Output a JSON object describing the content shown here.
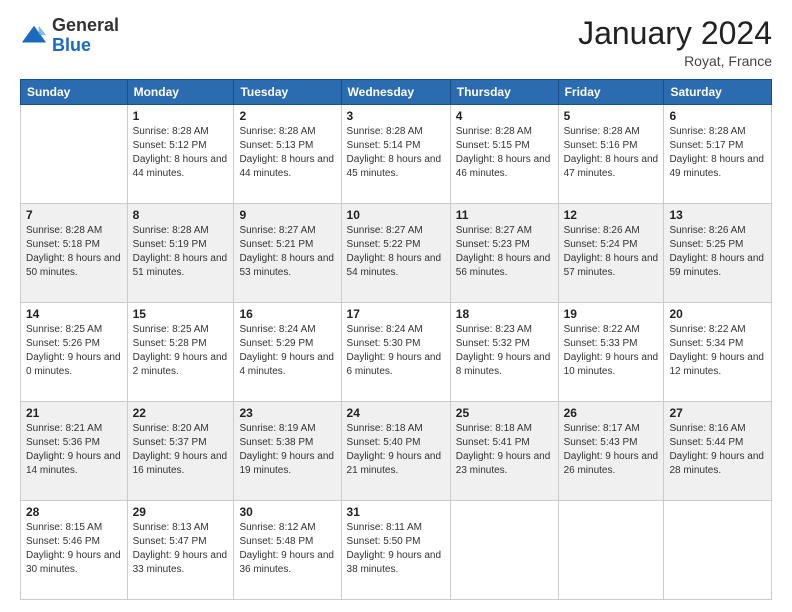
{
  "logo": {
    "general": "General",
    "blue": "Blue"
  },
  "header": {
    "title": "January 2024",
    "location": "Royat, France"
  },
  "weekdays": [
    "Sunday",
    "Monday",
    "Tuesday",
    "Wednesday",
    "Thursday",
    "Friday",
    "Saturday"
  ],
  "weeks": [
    [
      {
        "day": "",
        "sunrise": "",
        "sunset": "",
        "daylight": ""
      },
      {
        "day": "1",
        "sunrise": "Sunrise: 8:28 AM",
        "sunset": "Sunset: 5:12 PM",
        "daylight": "Daylight: 8 hours and 44 minutes."
      },
      {
        "day": "2",
        "sunrise": "Sunrise: 8:28 AM",
        "sunset": "Sunset: 5:13 PM",
        "daylight": "Daylight: 8 hours and 44 minutes."
      },
      {
        "day": "3",
        "sunrise": "Sunrise: 8:28 AM",
        "sunset": "Sunset: 5:14 PM",
        "daylight": "Daylight: 8 hours and 45 minutes."
      },
      {
        "day": "4",
        "sunrise": "Sunrise: 8:28 AM",
        "sunset": "Sunset: 5:15 PM",
        "daylight": "Daylight: 8 hours and 46 minutes."
      },
      {
        "day": "5",
        "sunrise": "Sunrise: 8:28 AM",
        "sunset": "Sunset: 5:16 PM",
        "daylight": "Daylight: 8 hours and 47 minutes."
      },
      {
        "day": "6",
        "sunrise": "Sunrise: 8:28 AM",
        "sunset": "Sunset: 5:17 PM",
        "daylight": "Daylight: 8 hours and 49 minutes."
      }
    ],
    [
      {
        "day": "7",
        "sunrise": "Sunrise: 8:28 AM",
        "sunset": "Sunset: 5:18 PM",
        "daylight": "Daylight: 8 hours and 50 minutes."
      },
      {
        "day": "8",
        "sunrise": "Sunrise: 8:28 AM",
        "sunset": "Sunset: 5:19 PM",
        "daylight": "Daylight: 8 hours and 51 minutes."
      },
      {
        "day": "9",
        "sunrise": "Sunrise: 8:27 AM",
        "sunset": "Sunset: 5:21 PM",
        "daylight": "Daylight: 8 hours and 53 minutes."
      },
      {
        "day": "10",
        "sunrise": "Sunrise: 8:27 AM",
        "sunset": "Sunset: 5:22 PM",
        "daylight": "Daylight: 8 hours and 54 minutes."
      },
      {
        "day": "11",
        "sunrise": "Sunrise: 8:27 AM",
        "sunset": "Sunset: 5:23 PM",
        "daylight": "Daylight: 8 hours and 56 minutes."
      },
      {
        "day": "12",
        "sunrise": "Sunrise: 8:26 AM",
        "sunset": "Sunset: 5:24 PM",
        "daylight": "Daylight: 8 hours and 57 minutes."
      },
      {
        "day": "13",
        "sunrise": "Sunrise: 8:26 AM",
        "sunset": "Sunset: 5:25 PM",
        "daylight": "Daylight: 8 hours and 59 minutes."
      }
    ],
    [
      {
        "day": "14",
        "sunrise": "Sunrise: 8:25 AM",
        "sunset": "Sunset: 5:26 PM",
        "daylight": "Daylight: 9 hours and 0 minutes."
      },
      {
        "day": "15",
        "sunrise": "Sunrise: 8:25 AM",
        "sunset": "Sunset: 5:28 PM",
        "daylight": "Daylight: 9 hours and 2 minutes."
      },
      {
        "day": "16",
        "sunrise": "Sunrise: 8:24 AM",
        "sunset": "Sunset: 5:29 PM",
        "daylight": "Daylight: 9 hours and 4 minutes."
      },
      {
        "day": "17",
        "sunrise": "Sunrise: 8:24 AM",
        "sunset": "Sunset: 5:30 PM",
        "daylight": "Daylight: 9 hours and 6 minutes."
      },
      {
        "day": "18",
        "sunrise": "Sunrise: 8:23 AM",
        "sunset": "Sunset: 5:32 PM",
        "daylight": "Daylight: 9 hours and 8 minutes."
      },
      {
        "day": "19",
        "sunrise": "Sunrise: 8:22 AM",
        "sunset": "Sunset: 5:33 PM",
        "daylight": "Daylight: 9 hours and 10 minutes."
      },
      {
        "day": "20",
        "sunrise": "Sunrise: 8:22 AM",
        "sunset": "Sunset: 5:34 PM",
        "daylight": "Daylight: 9 hours and 12 minutes."
      }
    ],
    [
      {
        "day": "21",
        "sunrise": "Sunrise: 8:21 AM",
        "sunset": "Sunset: 5:36 PM",
        "daylight": "Daylight: 9 hours and 14 minutes."
      },
      {
        "day": "22",
        "sunrise": "Sunrise: 8:20 AM",
        "sunset": "Sunset: 5:37 PM",
        "daylight": "Daylight: 9 hours and 16 minutes."
      },
      {
        "day": "23",
        "sunrise": "Sunrise: 8:19 AM",
        "sunset": "Sunset: 5:38 PM",
        "daylight": "Daylight: 9 hours and 19 minutes."
      },
      {
        "day": "24",
        "sunrise": "Sunrise: 8:18 AM",
        "sunset": "Sunset: 5:40 PM",
        "daylight": "Daylight: 9 hours and 21 minutes."
      },
      {
        "day": "25",
        "sunrise": "Sunrise: 8:18 AM",
        "sunset": "Sunset: 5:41 PM",
        "daylight": "Daylight: 9 hours and 23 minutes."
      },
      {
        "day": "26",
        "sunrise": "Sunrise: 8:17 AM",
        "sunset": "Sunset: 5:43 PM",
        "daylight": "Daylight: 9 hours and 26 minutes."
      },
      {
        "day": "27",
        "sunrise": "Sunrise: 8:16 AM",
        "sunset": "Sunset: 5:44 PM",
        "daylight": "Daylight: 9 hours and 28 minutes."
      }
    ],
    [
      {
        "day": "28",
        "sunrise": "Sunrise: 8:15 AM",
        "sunset": "Sunset: 5:46 PM",
        "daylight": "Daylight: 9 hours and 30 minutes."
      },
      {
        "day": "29",
        "sunrise": "Sunrise: 8:13 AM",
        "sunset": "Sunset: 5:47 PM",
        "daylight": "Daylight: 9 hours and 33 minutes."
      },
      {
        "day": "30",
        "sunrise": "Sunrise: 8:12 AM",
        "sunset": "Sunset: 5:48 PM",
        "daylight": "Daylight: 9 hours and 36 minutes."
      },
      {
        "day": "31",
        "sunrise": "Sunrise: 8:11 AM",
        "sunset": "Sunset: 5:50 PM",
        "daylight": "Daylight: 9 hours and 38 minutes."
      },
      {
        "day": "",
        "sunrise": "",
        "sunset": "",
        "daylight": ""
      },
      {
        "day": "",
        "sunrise": "",
        "sunset": "",
        "daylight": ""
      },
      {
        "day": "",
        "sunrise": "",
        "sunset": "",
        "daylight": ""
      }
    ]
  ]
}
